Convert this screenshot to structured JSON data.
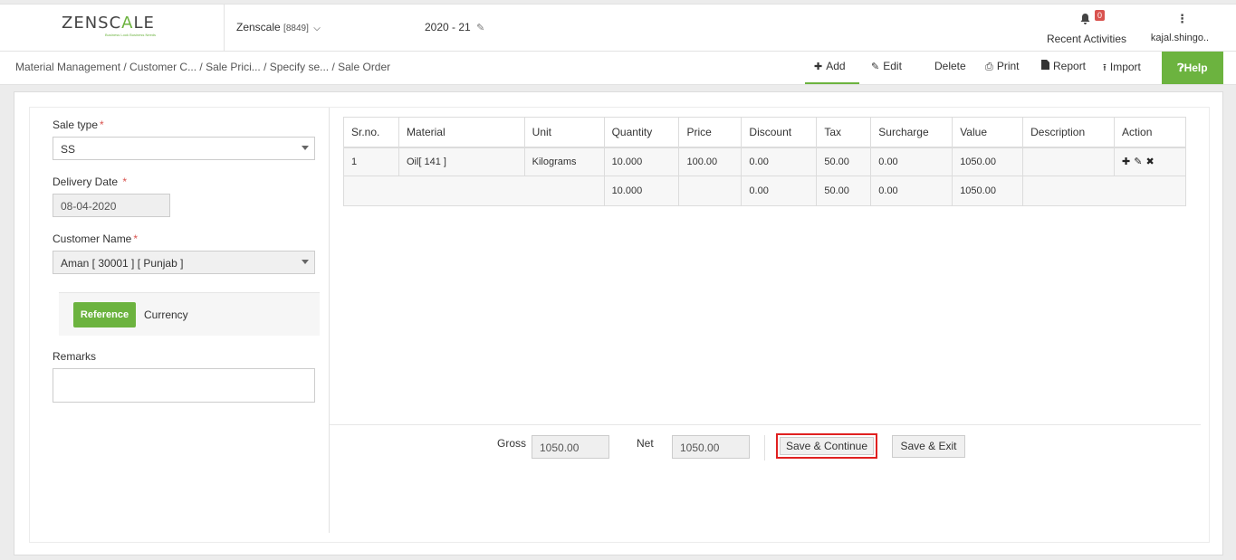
{
  "header": {
    "logo": {
      "prefix": "ZENSC",
      "accent": "A",
      "suffix": "LE",
      "tagline": "Business Look Business Needs"
    },
    "company": {
      "name": "Zenscale",
      "code": "[8849]"
    },
    "fiscal_year": "2020 - 21",
    "notifications": {
      "count": "0",
      "label": "Recent Activities"
    },
    "user": {
      "name": "kajal.shingo.."
    }
  },
  "breadcrumb": "Material Management  / Customer C... / Sale Prici... / Specify se... / Sale Order",
  "toolbar": {
    "add": "Add",
    "edit": "Edit",
    "delete": "Delete",
    "print": "Print",
    "report": "Report",
    "import": "Import",
    "help": "Help"
  },
  "form": {
    "sale_type": {
      "label": "Sale type",
      "value": "SS"
    },
    "delivery_date": {
      "label": "Delivery Date",
      "value": "08-04-2020"
    },
    "customer_name": {
      "label": "Customer Name",
      "value": "Aman [ 30001 ] [ Punjab ]"
    },
    "tabs": {
      "reference": "Reference",
      "currency": "Currency"
    },
    "remarks": {
      "label": "Remarks",
      "value": ""
    }
  },
  "table": {
    "columns": [
      "Sr.no.",
      "Material",
      "Unit",
      "Quantity",
      "Price",
      "Discount",
      "Tax",
      "Surcharge",
      "Value",
      "Description",
      "Action"
    ],
    "rows": [
      {
        "srno": "1",
        "material": "Oil[ 141 ]",
        "unit": "Kilograms",
        "quantity": "10.000",
        "price": "100.00",
        "discount": "0.00",
        "tax": "50.00",
        "surcharge": "0.00",
        "value": "1050.00",
        "description": ""
      }
    ],
    "totals": {
      "quantity": "10.000",
      "discount": "0.00",
      "tax": "50.00",
      "surcharge": "0.00",
      "value": "1050.00"
    }
  },
  "footer": {
    "gross_label": "Gross",
    "gross_value": "1050.00",
    "net_label": "Net",
    "net_value": "1050.00",
    "save_continue": "Save & Continue",
    "save_exit": "Save & Exit"
  },
  "colors": {
    "accent": "#6cb33f",
    "highlight": "#e02020",
    "badge": "#d9534f"
  }
}
